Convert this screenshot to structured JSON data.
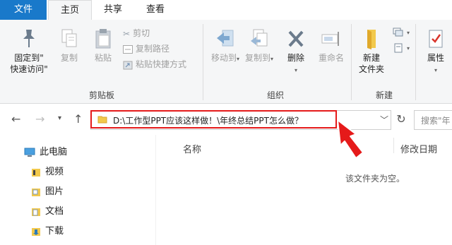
{
  "tabs": {
    "file": "文件",
    "home": "主页",
    "share": "共享",
    "view": "查看"
  },
  "ribbon": {
    "pin_quick_access": "固定到\"\n快速访问\"",
    "pin_line1": "固定到\"",
    "pin_line2": "快速访问\"",
    "copy": "复制",
    "paste": "粘贴",
    "cut": "剪切",
    "copy_path": "复制路径",
    "paste_shortcut": "粘贴快捷方式",
    "move_to": "移动到",
    "copy_to": "复制到",
    "delete": "删除",
    "rename": "重命名",
    "new_folder_line1": "新建",
    "new_folder_line2": "文件夹",
    "properties": "属性",
    "group_clipboard": "剪贴板",
    "group_organize": "组织",
    "group_new": "新建"
  },
  "address": {
    "path": "D:\\工作型PPT应该这样做！\\年终总结PPT怎么做？",
    "search_placeholder": "搜索\"年"
  },
  "nav": {
    "items": [
      {
        "label": "此电脑",
        "icon": "computer-icon"
      },
      {
        "label": "视频",
        "icon": "video-folder-icon"
      },
      {
        "label": "图片",
        "icon": "pictures-folder-icon"
      },
      {
        "label": "文档",
        "icon": "documents-folder-icon"
      },
      {
        "label": "下载",
        "icon": "downloads-folder-icon"
      }
    ]
  },
  "content": {
    "col_name": "名称",
    "col_modified": "修改日期",
    "empty_message": "该文件夹为空。"
  },
  "colors": {
    "accent": "#1979ca",
    "highlight": "#e51a1a"
  }
}
